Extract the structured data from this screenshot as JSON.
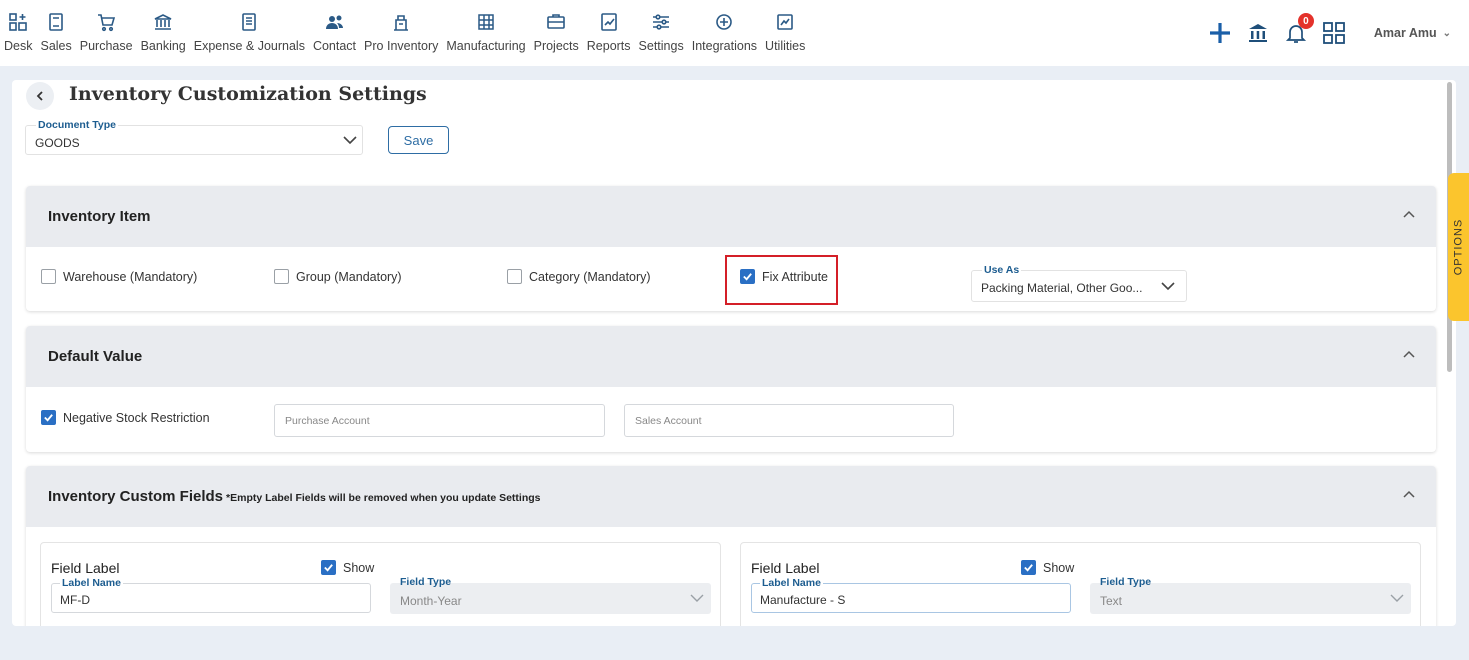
{
  "nav": {
    "items": [
      {
        "label": "Desk",
        "icon": "desk-icon"
      },
      {
        "label": "Sales",
        "icon": "sales-icon"
      },
      {
        "label": "Purchase",
        "icon": "cart-icon"
      },
      {
        "label": "Banking",
        "icon": "bank-icon"
      },
      {
        "label": "Expense & Journals",
        "icon": "journal-icon"
      },
      {
        "label": "Contact",
        "icon": "contacts-icon"
      },
      {
        "label": "Pro Inventory",
        "icon": "inventory-icon"
      },
      {
        "label": "Manufacturing",
        "icon": "factory-icon"
      },
      {
        "label": "Projects",
        "icon": "projects-icon"
      },
      {
        "label": "Reports",
        "icon": "reports-icon"
      },
      {
        "label": "Settings",
        "icon": "sliders-icon"
      },
      {
        "label": "Integrations",
        "icon": "integrations-icon"
      },
      {
        "label": "Utilities",
        "icon": "utilities-icon"
      }
    ],
    "notification_count": "0",
    "user_name": "Amar Amu"
  },
  "page": {
    "title": "Inventory Customization Settings",
    "document_type_label": "Document Type",
    "document_type_value": "GOODS",
    "save_label": "Save"
  },
  "inventory_item": {
    "title": "Inventory Item",
    "checkboxes": [
      {
        "label": "Warehouse (Mandatory)",
        "checked": false
      },
      {
        "label": "Group (Mandatory)",
        "checked": false
      },
      {
        "label": "Category (Mandatory)",
        "checked": false
      },
      {
        "label": "Fix Attribute",
        "checked": true
      }
    ],
    "use_as_label": "Use As",
    "use_as_value": "Packing Material, Other Goo..."
  },
  "default_value": {
    "title": "Default Value",
    "negative_stock_label": "Negative Stock Restriction",
    "negative_stock_checked": true,
    "purchase_account_placeholder": "Purchase Account",
    "sales_account_placeholder": "Sales Account"
  },
  "custom_fields": {
    "title": "Inventory Custom Fields",
    "note": "*Empty Label Fields will be removed when you update Settings",
    "cards": [
      {
        "field_label": "Field Label",
        "show_label": "Show",
        "label_name_label": "Label Name",
        "label_name_value": "MF-D",
        "field_type_label": "Field Type",
        "field_type_value": "Month-Year"
      },
      {
        "field_label": "Field Label",
        "show_label": "Show",
        "label_name_label": "Label Name",
        "label_name_value": "Manufacture - S",
        "field_type_label": "Field Type",
        "field_type_value": "Text"
      }
    ]
  },
  "options_tab": "OPTIONS",
  "colors": {
    "accent": "#2a6fc4",
    "highlight": "#d41f28",
    "options_tab": "#fbc52d"
  }
}
